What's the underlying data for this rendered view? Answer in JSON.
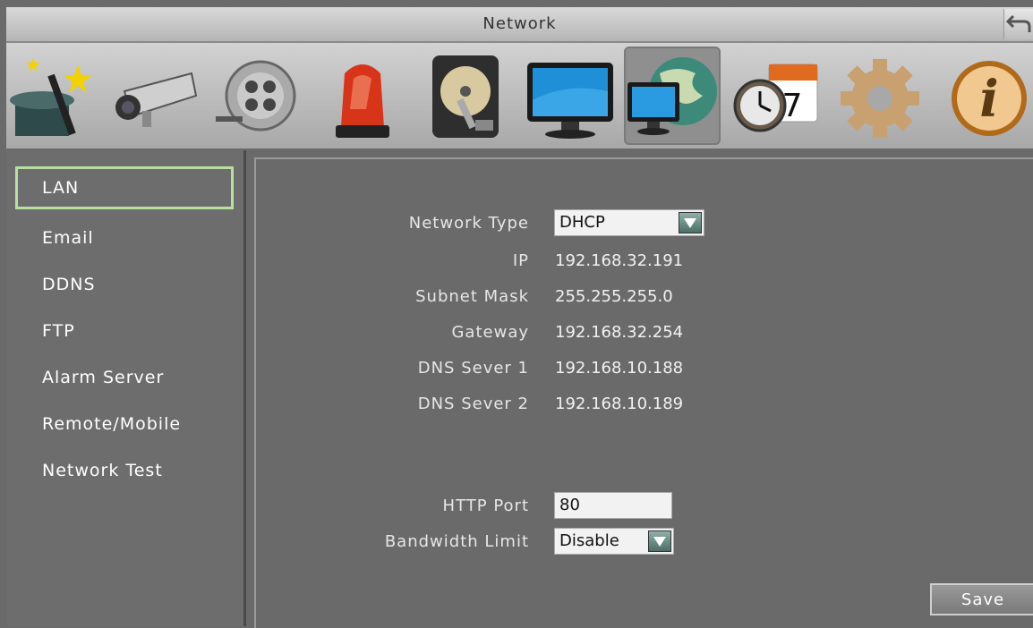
{
  "window": {
    "title": "Network"
  },
  "toolbar": {
    "icons": [
      "wizard-icon",
      "camera-icon",
      "record-icon",
      "alarm-icon",
      "disk-icon",
      "display-icon",
      "network-icon",
      "schedule-icon",
      "system-icon",
      "info-icon"
    ],
    "active": "network-icon"
  },
  "sidebar": {
    "items": [
      {
        "label": "LAN",
        "selected": true
      },
      {
        "label": "Email"
      },
      {
        "label": "DDNS"
      },
      {
        "label": "FTP"
      },
      {
        "label": "Alarm Server"
      },
      {
        "label": "Remote/Mobile"
      },
      {
        "label": "Network Test"
      }
    ]
  },
  "lan": {
    "network_type_label": "Network Type",
    "network_type_value": "DHCP",
    "ip_label": "IP",
    "ip_value": "192.168.32.191",
    "subnet_label": "Subnet Mask",
    "subnet_value": "255.255.255.0",
    "gateway_label": "Gateway",
    "gateway_value": "192.168.32.254",
    "dns1_label": "DNS Sever 1",
    "dns1_value": "192.168.10.188",
    "dns2_label": "DNS Sever 2",
    "dns2_value": "192.168.10.189",
    "http_port_label": "HTTP Port",
    "http_port_value": "80",
    "bandwidth_label": "Bandwidth Limit",
    "bandwidth_value": "Disable"
  },
  "buttons": {
    "save": "Save"
  },
  "colors": {
    "selected_border": "#b8e0a0",
    "dropdown_arrow": "#4d6e66"
  }
}
